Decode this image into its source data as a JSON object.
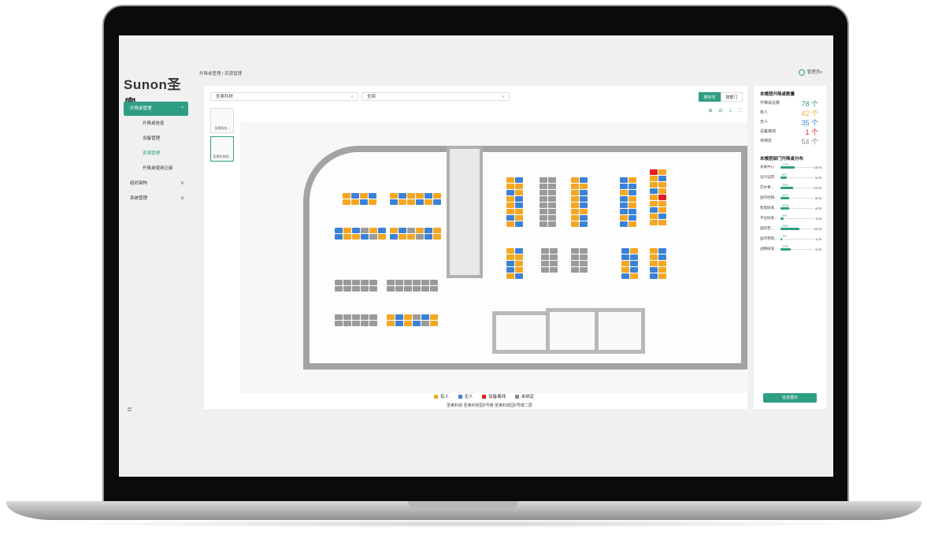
{
  "sidebar": {
    "logo": "Sunon圣奥",
    "items": [
      {
        "label": "升降桌管理",
        "chev": "^"
      },
      {
        "label": "升降桌信息"
      },
      {
        "label": "设备管理"
      },
      {
        "label": "资源管理"
      },
      {
        "label": "升降桌使用记录"
      },
      {
        "label": "组织架构",
        "chev": "v"
      },
      {
        "label": "系统管理",
        "chev": "v"
      }
    ],
    "collapse_icon": "≣"
  },
  "header": {
    "breadcrumb": "升降桌管理 / 资源管理",
    "user": "管理员",
    "user_chev": "v"
  },
  "filters": {
    "company": "圣奥科技",
    "scope": "全部",
    "arrow": "∨"
  },
  "toggle": {
    "by_status": "按状态",
    "by_dept": "按部门"
  },
  "toolbar_icons": "⊞ ⊟ ⊥ ⛶",
  "floors": [
    {
      "label": "圣奥科技..."
    },
    {
      "label": "圣奥科技园..."
    }
  ],
  "legend": [
    {
      "label": "有人",
      "color": "#f5a623"
    },
    {
      "label": "无人",
      "color": "#3b82d6"
    },
    {
      "label": "设备离线",
      "color": "#e02020"
    },
    {
      "label": "未绑定",
      "color": "#8a8a8a"
    }
  ],
  "caption": "圣奥科技-圣奥科技园6号楼-圣奥科技园6号楼二层",
  "stats": {
    "title": "本楼层升降桌数量",
    "rows": [
      {
        "label": "升降桌总数",
        "value": "78 个",
        "color": "#2e9e83"
      },
      {
        "label": "有人",
        "value": "42 个",
        "color": "#f5a623"
      },
      {
        "label": "无人",
        "value": "35 个",
        "color": "#3b82d6"
      },
      {
        "label": "设备离线",
        "value": "1 个",
        "color": "#e02020"
      },
      {
        "label": "未绑定",
        "value": "54 个",
        "color": "#8a8a8a"
      }
    ]
  },
  "depts": {
    "title": "本楼层部门升降桌分布",
    "rows": [
      {
        "label": "总裁中心",
        "pct": "17%",
        "ratio": "13/78",
        "frac": 0.17
      },
      {
        "label": "设计运营...",
        "pct": "8%",
        "ratio": "6/78",
        "frac": 0.08
      },
      {
        "label": "实木事...",
        "pct": "15%",
        "ratio": "12/78",
        "frac": 0.15
      },
      {
        "label": "国内经销...",
        "pct": "10%",
        "ratio": "8/78",
        "frac": 0.1
      },
      {
        "label": "智能研发...",
        "pct": "10%",
        "ratio": "8/78",
        "frac": 0.1
      },
      {
        "label": "平台研发...",
        "pct": "4%",
        "ratio": "3/78",
        "frac": 0.04
      },
      {
        "label": "国际营...",
        "pct": "23%",
        "ratio": "18/78",
        "frac": 0.23
      },
      {
        "label": "国内营销...",
        "pct": "1%",
        "ratio": "1/78",
        "frac": 0.01
      },
      {
        "label": "战略研发...",
        "pct": "12%",
        "ratio": "9/78",
        "frac": 0.12
      }
    ]
  },
  "details_button": "信息展示"
}
